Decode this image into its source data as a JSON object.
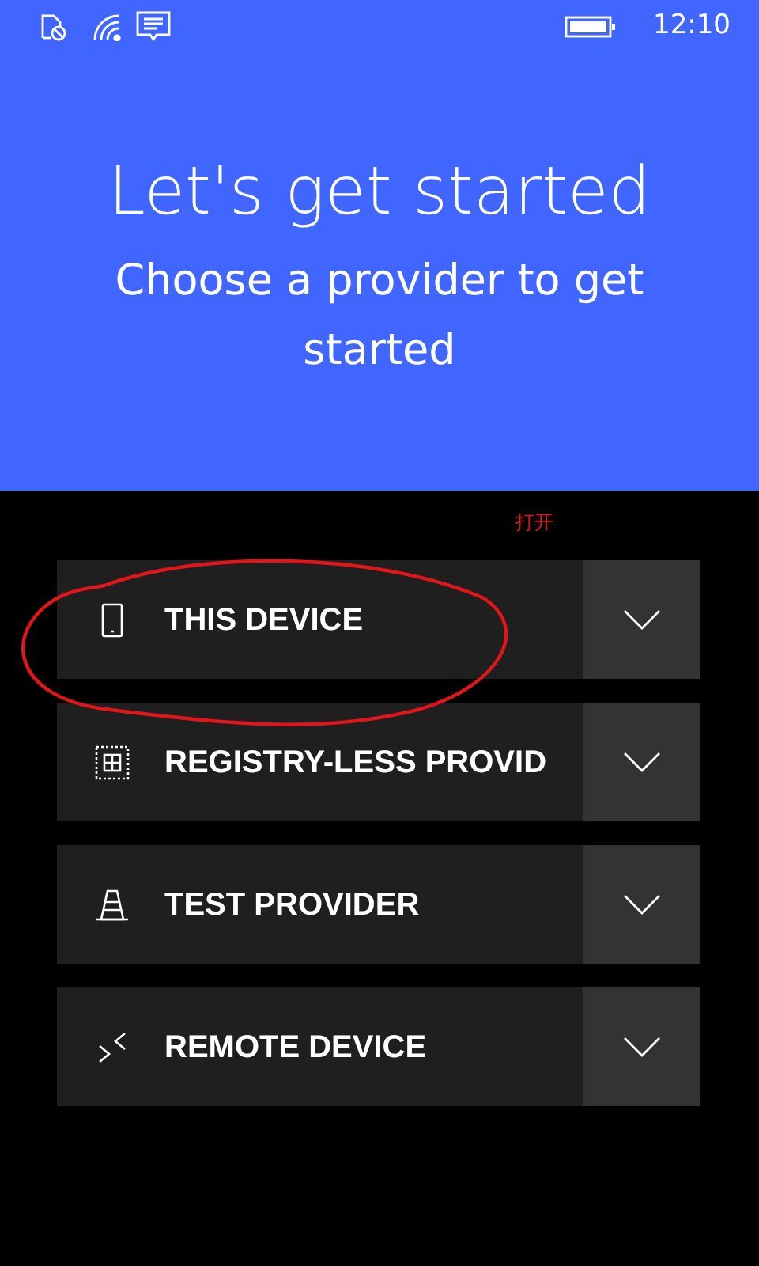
{
  "status_bar": {
    "time": "12:10"
  },
  "header": {
    "title": "Let's get started",
    "subtitle": "Choose a provider to get started"
  },
  "annotation": {
    "text": "打开"
  },
  "providers": [
    {
      "label": "THIS DEVICE",
      "kind": "phone",
      "circled": true
    },
    {
      "label": "REGISTRY-LESS PROVID",
      "kind": "grid",
      "circled": false
    },
    {
      "label": "TEST PROVIDER",
      "kind": "cone",
      "circled": false
    },
    {
      "label": "REMOTE DEVICE",
      "kind": "remote",
      "circled": false
    }
  ]
}
